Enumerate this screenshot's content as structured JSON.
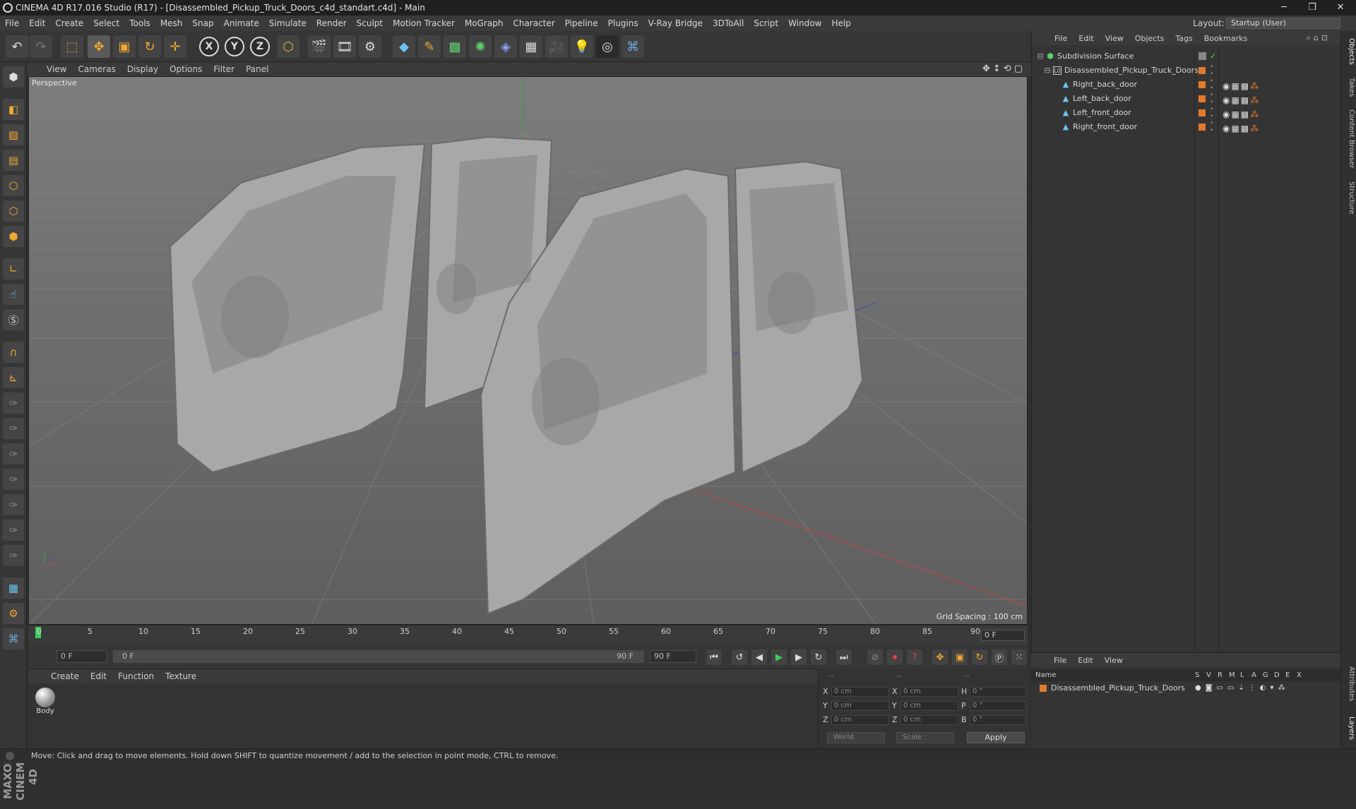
{
  "window": {
    "title": "CINEMA 4D R17.016 Studio (R17) - [Disassembled_Pickup_Truck_Doors_c4d_standart.c4d] - Main",
    "minimize": "─",
    "maximize": "❐",
    "close": "✕"
  },
  "menubar": {
    "items": [
      "File",
      "Edit",
      "Create",
      "Select",
      "Tools",
      "Mesh",
      "Snap",
      "Animate",
      "Simulate",
      "Render",
      "Sculpt",
      "Motion Tracker",
      "MoGraph",
      "Character",
      "Pipeline",
      "Plugins",
      "V-Ray Bridge",
      "3DToAll",
      "Script",
      "Window",
      "Help"
    ],
    "layout_label": "Layout:",
    "layout_value": "Startup (User)"
  },
  "toolbar": {
    "axis_x": "X",
    "axis_y": "Y",
    "axis_z": "Z"
  },
  "viewport": {
    "menu": [
      "View",
      "Cameras",
      "Display",
      "Options",
      "Filter",
      "Panel"
    ],
    "label": "Perspective",
    "grid_spacing": "Grid Spacing : 100 cm"
  },
  "timeline": {
    "ticks": [
      "0",
      "5",
      "10",
      "15",
      "20",
      "25",
      "30",
      "35",
      "40",
      "45",
      "50",
      "55",
      "60",
      "65",
      "70",
      "75",
      "80",
      "85",
      "90"
    ],
    "current_frame": "0 F"
  },
  "transport": {
    "start_field": "0 F",
    "range_start": "0 F",
    "range_end": "90 F",
    "end_field": "90 F"
  },
  "material_manager": {
    "menu": [
      "Create",
      "Edit",
      "Function",
      "Texture"
    ],
    "materials": [
      {
        "label": "Body"
      }
    ]
  },
  "coordinates": {
    "header_dashes": [
      "--",
      "--",
      "--"
    ],
    "rows": [
      {
        "a": "X",
        "av": "0 cm",
        "b": "X",
        "bv": "0 cm",
        "c": "H",
        "cv": "0 °"
      },
      {
        "a": "Y",
        "av": "0 cm",
        "b": "Y",
        "bv": "0 cm",
        "c": "P",
        "cv": "0 °"
      },
      {
        "a": "Z",
        "av": "0 cm",
        "b": "Z",
        "bv": "0 cm",
        "c": "B",
        "cv": "0 °"
      }
    ],
    "mode1": "World",
    "mode2": "Scale",
    "apply": "Apply"
  },
  "object_manager": {
    "menu": [
      "File",
      "Edit",
      "View",
      "Objects",
      "Tags",
      "Bookmarks"
    ],
    "objects": [
      {
        "name": "Subdivision Surface",
        "icon": "subdivision-icon"
      },
      {
        "name": "Disassembled_Pickup_Truck_Doors",
        "icon": "null-object-icon"
      },
      {
        "name": "Right_back_door",
        "icon": "polygon-object-icon"
      },
      {
        "name": "Left_back_door",
        "icon": "polygon-object-icon"
      },
      {
        "name": "Left_front_door",
        "icon": "polygon-object-icon"
      },
      {
        "name": "Right_front_door",
        "icon": "polygon-object-icon"
      }
    ]
  },
  "layer_manager": {
    "menu": [
      "File",
      "Edit",
      "View"
    ],
    "columns": [
      "Name",
      "S",
      "V",
      "R",
      "M",
      "L",
      "A",
      "G",
      "D",
      "E",
      "X"
    ],
    "layers": [
      {
        "name": "Disassembled_Pickup_Truck_Doors",
        "color": "#e07b2c"
      }
    ]
  },
  "right_tabs": [
    "Objects",
    "Takes",
    "Content Browser",
    "Structure",
    "Attributes",
    "Layers"
  ],
  "statusbar": {
    "text": "Move: Click and drag to move elements. Hold down SHIFT to quantize movement / add to the selection in point mode, CTRL to remove."
  },
  "branding": {
    "logo": "MAXON CINEMA 4D"
  }
}
